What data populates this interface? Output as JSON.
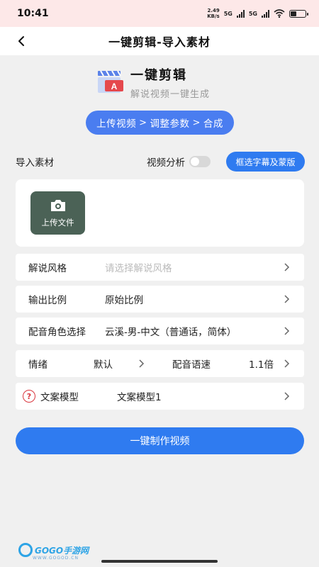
{
  "status": {
    "time": "10:41",
    "net_speed_value": "2.49",
    "net_speed_unit": "KB/s",
    "net1": "5G",
    "net2": "5G"
  },
  "header": {
    "title": "一键剪辑-导入素材"
  },
  "brand": {
    "name": "一键剪辑",
    "subtitle": "解说视频一键生成"
  },
  "steps": [
    "上传视频",
    "调整参数",
    "合成"
  ],
  "steps_separator": ">",
  "import": {
    "label": "导入素材",
    "analysis_label": "视频分析",
    "analysis_enabled": false,
    "mask_button": "框选字幕及蒙版",
    "upload_label": "上传文件"
  },
  "settings": {
    "style": {
      "label": "解说风格",
      "placeholder": "请选择解说风格"
    },
    "ratio": {
      "label": "输出比例",
      "value": "原始比例"
    },
    "voice": {
      "label": "配音角色选择",
      "value": "云溪-男-中文（普通话，简体）"
    },
    "emotion": {
      "label": "情绪",
      "value": "默认"
    },
    "speed": {
      "label": "配音语速",
      "value": "1.1倍"
    },
    "copy_model": {
      "label": "文案模型",
      "value": "文案模型1",
      "help": "?"
    }
  },
  "actions": {
    "make_video": "一键制作视频"
  },
  "watermark": {
    "text": "GOGO手游网",
    "sub": "WWW.GOGOD.CN"
  },
  "colors": {
    "primary": "#2f7bf0",
    "pill": "#4a7df0",
    "upload_bg": "#4b6256",
    "help_red": "#d9363e"
  }
}
